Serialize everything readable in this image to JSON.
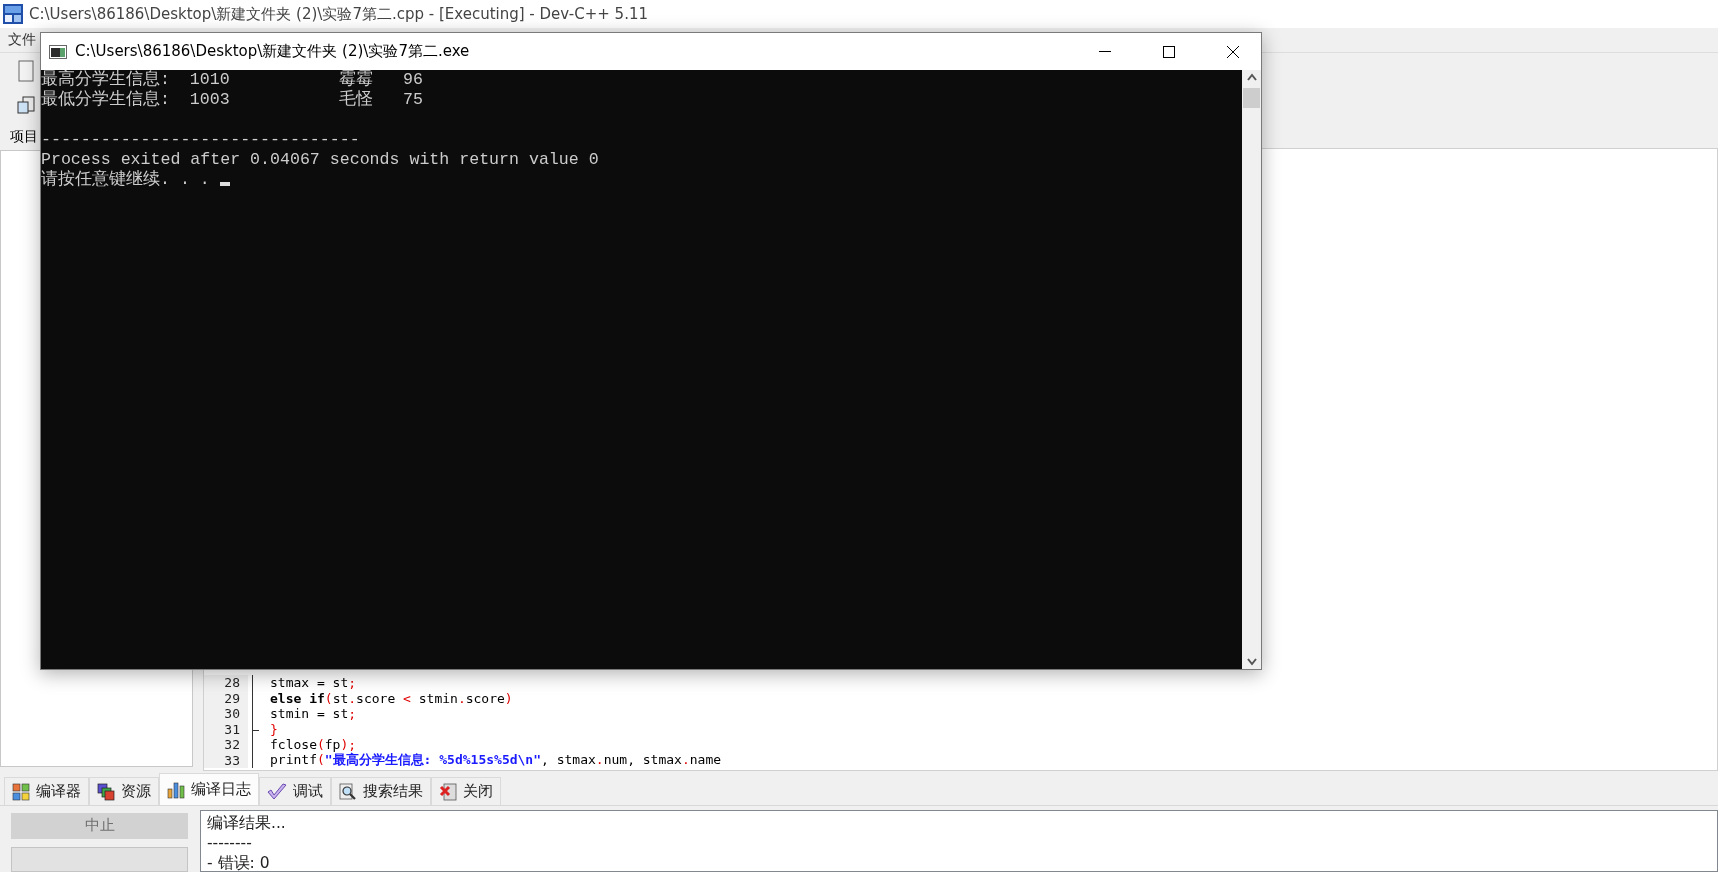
{
  "ide_window": {
    "title": "C:\\Users\\86186\\Desktop\\新建文件夹 (2)\\实验7第二.cpp - [Executing] - Dev-C++ 5.11"
  },
  "menu": [
    "文件"
  ],
  "project_panel": {
    "tab": "项目"
  },
  "editor": {
    "lines": [
      {
        "number": "28",
        "fold_end": false,
        "tokens": [
          {
            "kind": "plain",
            "text": "stmax = st"
          },
          {
            "kind": "symbol",
            "text": ";"
          }
        ]
      },
      {
        "number": "29",
        "fold_end": false,
        "tokens": [
          {
            "kind": "keyword",
            "text": "else if"
          },
          {
            "kind": "symbol",
            "text": "("
          },
          {
            "kind": "plain",
            "text": "st"
          },
          {
            "kind": "symbol",
            "text": "."
          },
          {
            "kind": "plain",
            "text": "score "
          },
          {
            "kind": "symbol",
            "text": "<"
          },
          {
            "kind": "plain",
            "text": " stmin"
          },
          {
            "kind": "symbol",
            "text": "."
          },
          {
            "kind": "plain",
            "text": "score"
          },
          {
            "kind": "symbol",
            "text": ")"
          }
        ]
      },
      {
        "number": "30",
        "fold_end": false,
        "tokens": [
          {
            "kind": "plain",
            "text": "stmin = st"
          },
          {
            "kind": "symbol",
            "text": ";"
          }
        ]
      },
      {
        "number": "31",
        "fold_end": true,
        "tokens": [
          {
            "kind": "symbol",
            "text": "}"
          }
        ]
      },
      {
        "number": "32",
        "fold_end": false,
        "tokens": [
          {
            "kind": "plain",
            "text": "fclose"
          },
          {
            "kind": "symbol",
            "text": "("
          },
          {
            "kind": "plain",
            "text": "fp"
          },
          {
            "kind": "symbol",
            "text": ");"
          }
        ]
      },
      {
        "number": "33",
        "fold_end": false,
        "tokens": [
          {
            "kind": "plain",
            "text": "printf"
          },
          {
            "kind": "symbol",
            "text": "("
          },
          {
            "kind": "string",
            "text": "\"最高分学生信息: %5d%15s%5d\\n\""
          },
          {
            "kind": "plain",
            "text": ", stmax"
          },
          {
            "kind": "symbol",
            "text": "."
          },
          {
            "kind": "plain",
            "text": "num, stmax"
          },
          {
            "kind": "symbol",
            "text": "."
          },
          {
            "kind": "plain",
            "text": "name"
          }
        ]
      }
    ]
  },
  "bottom_tabs": [
    {
      "label": "编译器",
      "selected": false
    },
    {
      "label": "资源",
      "selected": false
    },
    {
      "label": "编译日志",
      "selected": true
    },
    {
      "label": "调试",
      "selected": false
    },
    {
      "label": "搜索结果",
      "selected": false
    },
    {
      "label": "关闭",
      "selected": false
    }
  ],
  "abort_button": {
    "label": "中止",
    "disabled": true
  },
  "compile_log": [
    "编译结果...",
    "--------",
    "- 错误: 0"
  ],
  "console": {
    "title": "C:\\Users\\86186\\Desktop\\新建文件夹 (2)\\实验7第二.exe",
    "program_output": [
      "最高分学生信息:  1010           霉霉   96",
      "最低分学生信息:  1003           毛怪   75"
    ],
    "exit_report": [
      "--------------------------------",
      "Process exited after 0.04067 seconds with return value 0",
      "请按任意键继续. . . "
    ],
    "cursor": true
  }
}
